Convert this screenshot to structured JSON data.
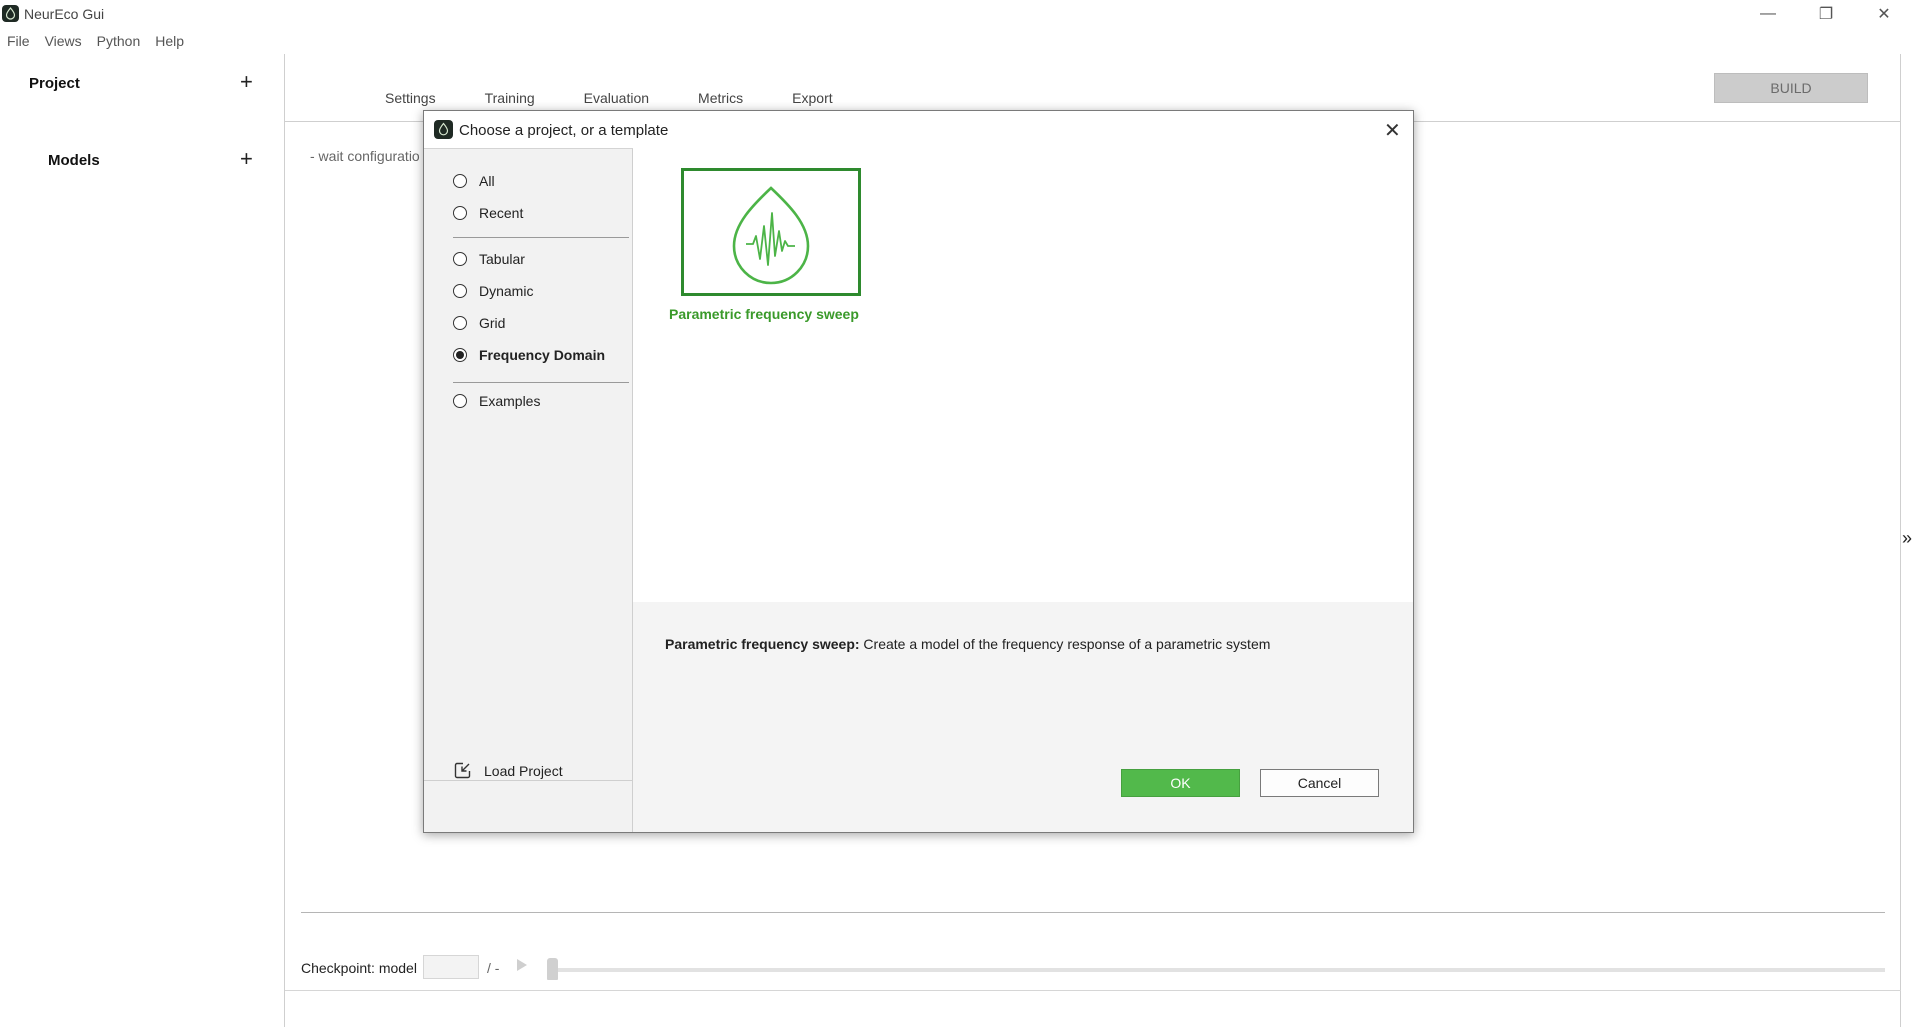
{
  "window": {
    "title": "NeurEco Gui",
    "controls": {
      "minimize": "—",
      "maximize": "❐",
      "close": "✕"
    }
  },
  "menu": [
    "File",
    "Views",
    "Python",
    "Help"
  ],
  "left_panel": {
    "project_label": "Project",
    "models_label": "Models",
    "add_symbol": "+"
  },
  "tabs": [
    "Settings",
    "Training",
    "Evaluation",
    "Metrics",
    "Export"
  ],
  "build_label": "BUILD",
  "status_text": "- wait configuratio",
  "expand_icon": "»",
  "checkpoint": {
    "label": "Checkpoint: model",
    "input_value": "",
    "total": "/ -"
  },
  "dialog": {
    "title": "Choose a project, or a template",
    "close": "✕",
    "filters": [
      {
        "label": "All",
        "checked": false
      },
      {
        "label": "Recent",
        "checked": false
      },
      {
        "label": "Tabular",
        "checked": false
      },
      {
        "label": "Dynamic",
        "checked": false
      },
      {
        "label": "Grid",
        "checked": false
      },
      {
        "label": "Frequency Domain",
        "checked": true
      },
      {
        "label": "Examples",
        "checked": false
      }
    ],
    "load_project_label": "Load Project",
    "template": {
      "name": "Parametric frequency sweep",
      "icon": "waveform-drop-icon",
      "color": "#3a9a2a"
    },
    "description": {
      "name": "Parametric frequency sweep:",
      "text": "Create a model of the frequency response of a parametric system"
    },
    "ok_label": "OK",
    "cancel_label": "Cancel"
  }
}
